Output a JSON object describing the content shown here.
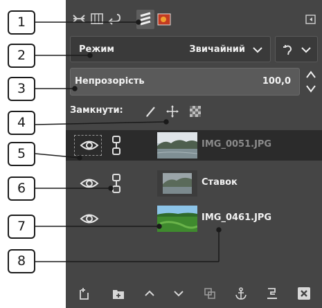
{
  "layers_panel": {
    "mode": {
      "label": "Режим",
      "value": "Звичайний"
    },
    "opacity": {
      "label": "Непрозорість",
      "value": "100,0"
    },
    "lock": {
      "label": "Замкнути:"
    },
    "layers": [
      {
        "name": "IMG_0051.JPG",
        "dimmed": true
      },
      {
        "name": "Ставок",
        "dimmed": false
      },
      {
        "name": "IMG_0461.JPG",
        "dimmed": false
      }
    ]
  },
  "callouts": [
    "1",
    "2",
    "3",
    "4",
    "5",
    "6",
    "7",
    "8"
  ],
  "colors": {
    "panel_bg": "#454545",
    "selected_row": "#2b2b2b",
    "text": "#f2f2f2",
    "dim_text": "#8a8a8a"
  }
}
